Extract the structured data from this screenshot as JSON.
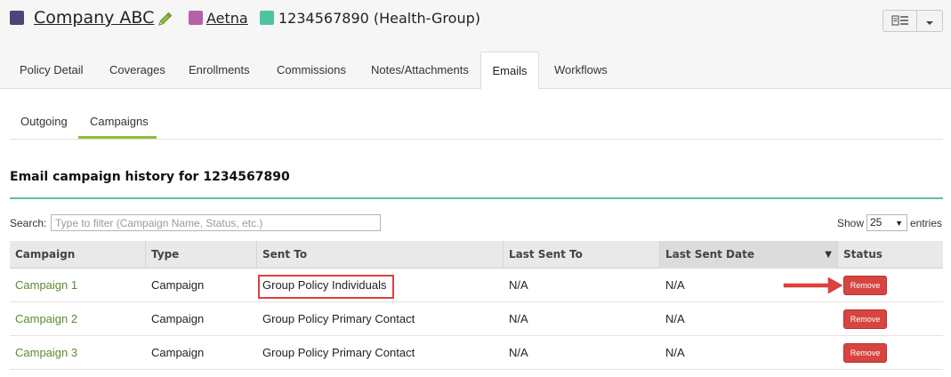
{
  "colors": {
    "company": "#4f4576",
    "carrier": "#b561a8",
    "policy": "#4fc3a1",
    "accent_green": "#8bbf3f",
    "section_line": "#5fbfa0",
    "link": "#5b8a2f",
    "remove": "#d64541",
    "highlight": "#e0403d"
  },
  "header": {
    "company_name": "Company ABC",
    "carrier_name": "Aetna",
    "policy_text": "1234567890 (Health-Group)",
    "icons": [
      "edit-pencil-icon",
      "list-view-icon",
      "caret-down-icon"
    ]
  },
  "tabs": [
    {
      "label": "Policy Detail"
    },
    {
      "label": "Coverages"
    },
    {
      "label": "Enrollments"
    },
    {
      "label": "Commissions"
    },
    {
      "label": "Notes/Attachments"
    },
    {
      "label": "Emails",
      "active": true
    },
    {
      "label": "Workflows"
    }
  ],
  "subtabs": [
    {
      "label": "Outgoing"
    },
    {
      "label": "Campaigns",
      "active": true
    }
  ],
  "section": {
    "title": "Email campaign history for 1234567890"
  },
  "search": {
    "label": "Search:",
    "placeholder": "Type to filter (Campaign Name, Status, etc.)",
    "value": ""
  },
  "show": {
    "label": "Show",
    "value": "25",
    "suffix": "entries"
  },
  "table": {
    "columns": [
      "Campaign",
      "Type",
      "Sent To",
      "Last Sent To",
      "Last Sent Date",
      "Status"
    ],
    "sorted_column": "Last Sent Date",
    "rows": [
      {
        "campaign": "Campaign 1",
        "type": "Campaign",
        "sent_to": "Group Policy Individuals",
        "last_sent_to": "N/A",
        "last_sent_date": "N/A",
        "status": "Remove"
      },
      {
        "campaign": "Campaign 2",
        "type": "Campaign",
        "sent_to": "Group Policy Primary Contact",
        "last_sent_to": "N/A",
        "last_sent_date": "N/A",
        "status": "Remove"
      },
      {
        "campaign": "Campaign 3",
        "type": "Campaign",
        "sent_to": "Group Policy Primary Contact",
        "last_sent_to": "N/A",
        "last_sent_date": "N/A",
        "status": "Remove"
      }
    ]
  }
}
